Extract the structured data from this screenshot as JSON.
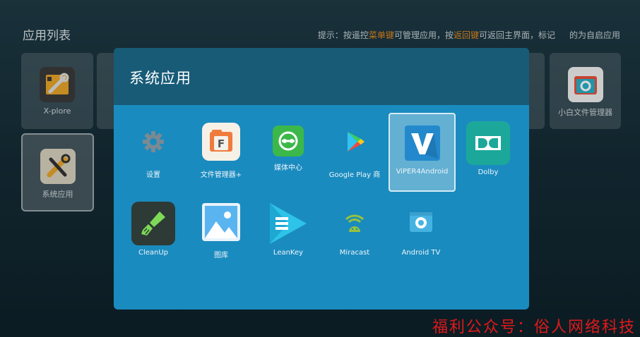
{
  "header": {
    "title": "应用列表",
    "hint": {
      "part1": "提示：按遥控",
      "menu_key": "菜单键",
      "part2": "可管理应用，按",
      "back_key": "返回键",
      "part3": "可返回主界面，标记",
      "part4": "的为自启应用"
    }
  },
  "background_tiles": [
    {
      "label": "X-plore",
      "icon": "xplore-icon"
    },
    {
      "label": "系统应用",
      "icon": "tools-icon",
      "selected": true
    },
    {
      "label": "小白文件管理器",
      "icon": "file-manager-icon"
    }
  ],
  "modal": {
    "title": "系统应用",
    "apps": [
      {
        "label": "设置",
        "icon": "gear-icon"
      },
      {
        "label": "文件管理器+",
        "icon": "file-manager-plus-icon"
      },
      {
        "label": "媒体中心",
        "icon": "media-center-icon"
      },
      {
        "label": "Google Play 商",
        "icon": "google-play-icon"
      },
      {
        "label": "ViPER4Android",
        "icon": "viper-icon",
        "focused": true
      },
      {
        "label": "Dolby",
        "icon": "dolby-icon"
      },
      {
        "label": "CleanUp",
        "icon": "cleanup-brush-icon"
      },
      {
        "label": "图库",
        "icon": "gallery-icon"
      },
      {
        "label": "LeanKey",
        "icon": "leankey-icon"
      },
      {
        "label": "Miracast",
        "icon": "miracast-icon"
      },
      {
        "label": "Android TV",
        "icon": "android-tv-icon"
      }
    ]
  },
  "watermark": "福利公众号：俗人网络科技",
  "colors": {
    "modal_body": "#1a8bbf",
    "modal_header": "#185b77",
    "hint_highlight": "#e58a1c",
    "watermark": "#e0191b"
  }
}
